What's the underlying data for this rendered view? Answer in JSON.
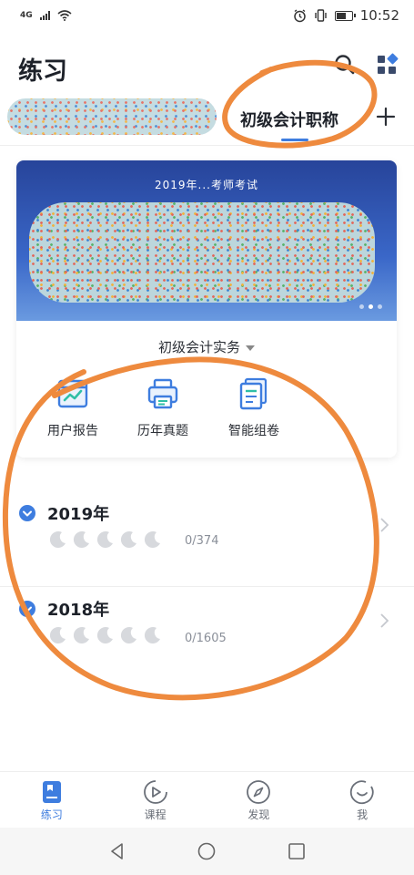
{
  "status_bar": {
    "network": "4G",
    "time": "10:52",
    "battery_level": 0.7
  },
  "header": {
    "title": "练习"
  },
  "tabs": {
    "active_label": "初级会计职称"
  },
  "banner": {
    "title": "2019年...考师考试",
    "slide_count": 3,
    "active_slide": 2
  },
  "card": {
    "subject": "初级会计实务",
    "tools": [
      {
        "label": "用户报告",
        "icon": "report-icon"
      },
      {
        "label": "历年真题",
        "icon": "printer-icon"
      },
      {
        "label": "智能组卷",
        "icon": "paper-stack-icon"
      }
    ]
  },
  "years": [
    {
      "year": "2019年",
      "progress": "0/374",
      "moons": 5
    },
    {
      "year": "2018年",
      "progress": "0/1605",
      "moons": 5
    }
  ],
  "bottom_nav": [
    {
      "label": "练习",
      "icon": "practice-icon",
      "active": true
    },
    {
      "label": "课程",
      "icon": "play-icon",
      "active": false
    },
    {
      "label": "发现",
      "icon": "compass-icon",
      "active": false
    },
    {
      "label": "我",
      "icon": "smile-icon",
      "active": false
    }
  ],
  "colors": {
    "accent": "#3e7ddf",
    "annotation": "#ee8a3e",
    "banner_top": "#27449a",
    "text": "#1d2129"
  }
}
